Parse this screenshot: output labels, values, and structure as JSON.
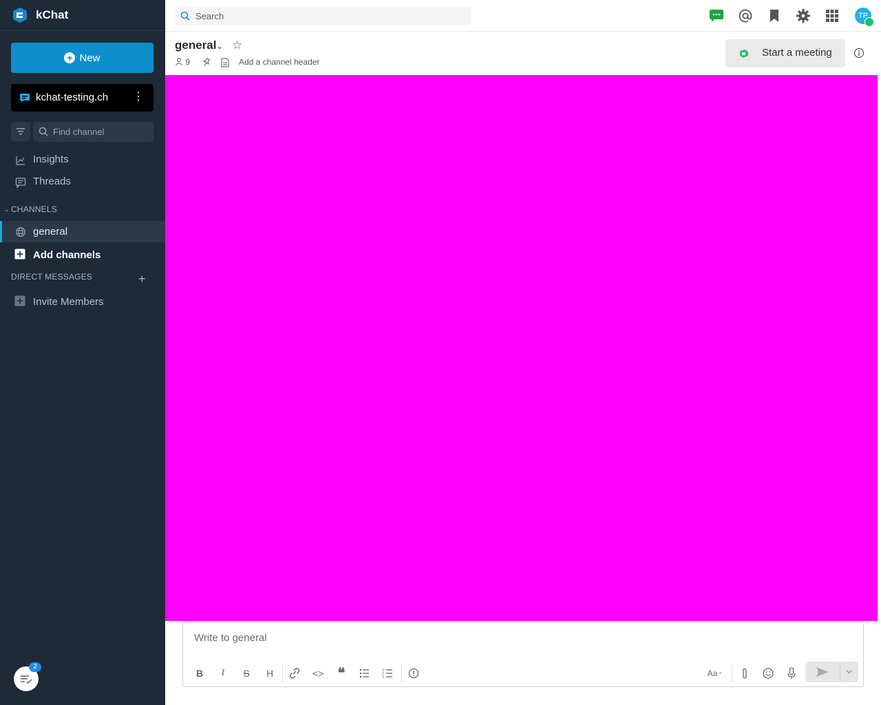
{
  "app": {
    "name": "kChat"
  },
  "sidebar": {
    "new_label": "New",
    "team_name": "kchat-testing.ch",
    "find_placeholder": "Find channel",
    "nav": [
      {
        "label": "Insights"
      },
      {
        "label": "Threads"
      }
    ],
    "channels_title": "CHANNELS",
    "channels": [
      {
        "label": "general"
      }
    ],
    "add_channels": "Add channels",
    "dm_title": "DIRECT MESSAGES",
    "invite": "Invite Members",
    "badge_count": "2"
  },
  "topbar": {
    "search_placeholder": "Search",
    "avatar_initials": "TP"
  },
  "channel": {
    "name": "general",
    "members": "9",
    "add_header": "Add a channel header",
    "meeting_label": "Start a meeting"
  },
  "composer": {
    "placeholder": "Write to general",
    "text_format": "Aa"
  },
  "colors": {
    "sidebar_bg": "#1e2a38",
    "accent": "#0d8fcb",
    "content_bg": "#ff00ff"
  }
}
